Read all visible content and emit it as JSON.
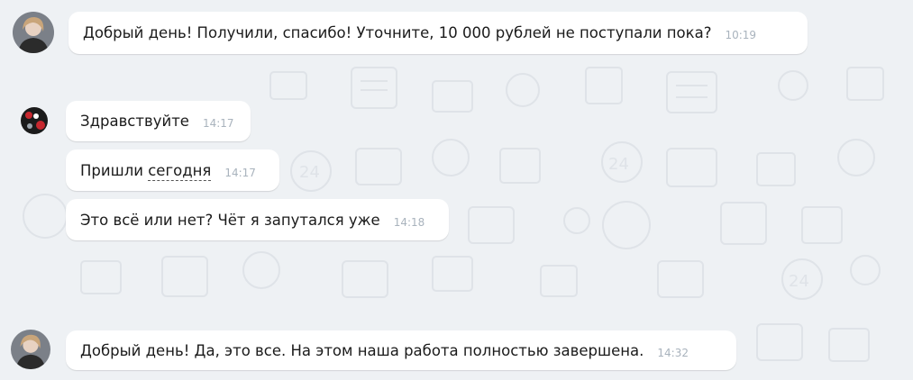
{
  "messages": [
    {
      "sender": "agent",
      "text": "Добрый день! Получили, спасибо! Уточните, 10 000 рублей не поступали пока?",
      "time": "10:19"
    },
    {
      "sender": "client",
      "text": "Здравствуйте",
      "time": "14:17"
    },
    {
      "sender": "client",
      "text_prefix": "Пришли ",
      "text_highlight": "сегодня",
      "time": "14:17"
    },
    {
      "sender": "client",
      "text": "Это всё или нет? Чёт я запутался уже",
      "time": "14:18"
    },
    {
      "sender": "agent",
      "text": "Добрый день! Да, это все. На этом наша работа полностью завершена.",
      "time": "14:32"
    }
  ],
  "colors": {
    "background": "#eef1f4",
    "bubble": "#ffffff",
    "time": "#a9b3bd",
    "text": "#1b1b1b"
  },
  "icons": [
    "agent-avatar",
    "client-avatar",
    "chat-doodle-pattern"
  ]
}
